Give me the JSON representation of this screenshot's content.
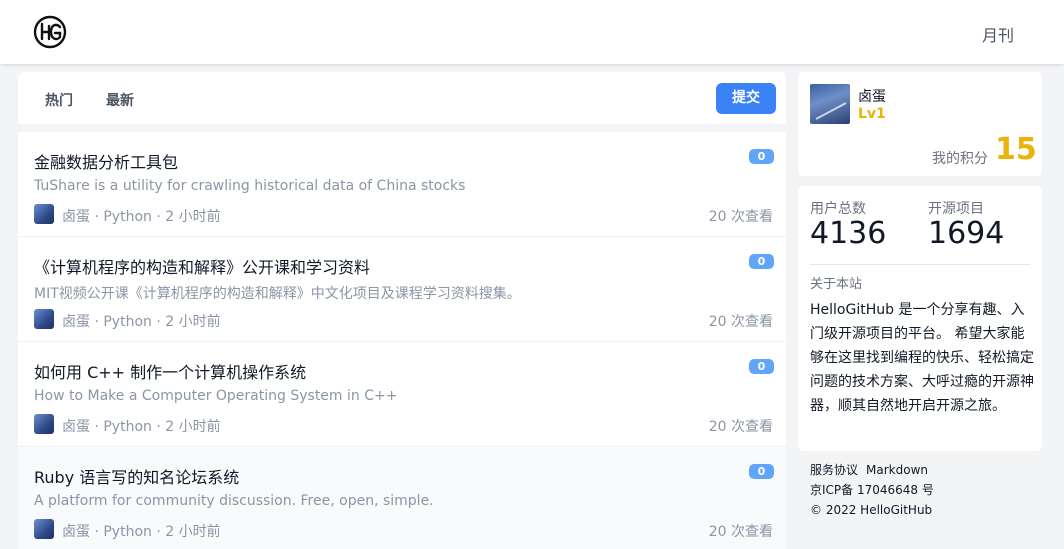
{
  "header": {
    "logo_icon": "hellogithub-logo-icon",
    "monthly_label": "月刊"
  },
  "tabs": {
    "hot": "热门",
    "latest": "最新",
    "submit_label": "提交"
  },
  "items": [
    {
      "title": "金融数据分析工具包",
      "description": "TuShare is a utility for crawling historical data of China stocks",
      "meta": "卤蛋 · Python · 2 小时前",
      "views": "20 次查看",
      "count": "0"
    },
    {
      "title": "《计算机程序的构造和解释》公开课和学习资料",
      "description": "MIT视频公开课《计算机程序的构造和解释》中文化项目及课程学习资料搜集。",
      "meta": "卤蛋 · Python · 2 小时前",
      "views": "20 次查看",
      "count": "0"
    },
    {
      "title": "如何用 C++ 制作一个计算机操作系统",
      "description": "How to Make a Computer Operating System in C++",
      "meta": "卤蛋 · Python · 2 小时前",
      "views": "20 次查看",
      "count": "0"
    },
    {
      "title": "Ruby 语言写的知名论坛系统",
      "description": "A platform for community discussion. Free, open, simple.",
      "meta": "卤蛋 · Python · 2 小时前",
      "views": "20 次查看",
      "count": "0"
    }
  ],
  "profile": {
    "name": "卤蛋",
    "level": "Lv1",
    "points_label": "我的积分",
    "points": "15"
  },
  "stats": {
    "users_label": "用户总数",
    "users_value": "4136",
    "projects_label": "开源项目",
    "projects_value": "1694",
    "about_label": "关于本站",
    "about_text": "HelloGitHub 是一个分享有趣、入门级开源项目的平台。 希望大家能够在这里找到编程的快乐、轻松搞定问题的技术方案、大呼过瘾的开源神器，顺其自然地开启开源之旅。"
  },
  "footer": {
    "terms": "服务协议",
    "markdown": "Markdown",
    "icp": "京ICP备 17046648 号",
    "copyright": "© 2022 HelloGitHub"
  },
  "colors": {
    "accent": "#3b82f6",
    "badge": "#60a5fa",
    "gold": "#eab308"
  }
}
